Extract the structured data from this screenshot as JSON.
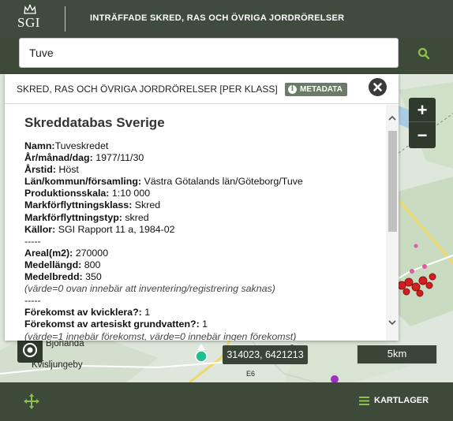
{
  "header": {
    "logo_text": "SGI",
    "title": "INTRÄFFADE SKRED, RAS OCH ÖVRIGA JORDRÖRELSER"
  },
  "search": {
    "value": "Tuve"
  },
  "map": {
    "zoom_in_label": "+",
    "zoom_out_label": "−",
    "coordinates": "314023, 6421213",
    "scale": "5km",
    "place_labels": [
      "Bjorlanda",
      "Kvisljungeby",
      "E6"
    ]
  },
  "popup": {
    "title": "SKRED, RAS OCH ÖVRIGA JORDRÖRELSER [PER KLASS]",
    "metadata_label": "METADATA",
    "heading": "Skreddatabas Sverige",
    "attributes": [
      {
        "label": "Namn:",
        "value": "Tuveskredet"
      },
      {
        "label": "År/månad/dag:",
        "value": " 1977/11/30"
      },
      {
        "label": "Årstid:",
        "value": " Höst"
      },
      {
        "label": "Län/kommun/församling:",
        "value": " Västra Götalands län/Göteborg/Tuve"
      },
      {
        "label": "Produktionsskala:",
        "value": " 1:10 000"
      },
      {
        "label": "Markförflyttningsklass:",
        "value": " Skred"
      },
      {
        "label": "Markförflyttningstyp:",
        "value": " skred"
      },
      {
        "label": "Källor:",
        "value": " SGI Rapport 11 a, 1984-02"
      }
    ],
    "separator": "-----",
    "measures": [
      {
        "label": "Areal(m2):",
        "value": " 270000"
      },
      {
        "label": "Medellängd:",
        "value": " 800"
      },
      {
        "label": "Medelbredd:",
        "value": " 350"
      }
    ],
    "measures_note": "(värde=0 ovan innebär att inventering/registrering saknas)",
    "conditions": [
      {
        "label": "Förekomst av kvicklera?:",
        "value": " 1"
      },
      {
        "label": "Förekomst av artesiskt grundvatten?:",
        "value": " 1"
      }
    ],
    "conditions_note": "(värde=1 innebär förekomst, värde=0 innebär ingen förekomst)"
  },
  "footer": {
    "layers_label": "KARTLAGER"
  },
  "colors": {
    "header_bg": "#3f4b3c",
    "accent_green": "#8fc04a",
    "map_bg": "#dfe7dc",
    "slide_marker": "#d41f1f",
    "selection_marker": "#1fbf8f"
  }
}
